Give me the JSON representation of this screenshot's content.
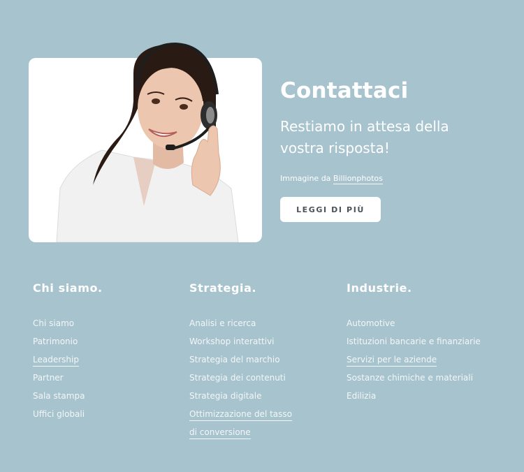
{
  "hero": {
    "image_alt": "Operatrice con cuffie e microfono sorridente",
    "title": "Contattaci",
    "subtitle": "Restiamo in attesa della vostra risposta!",
    "credit_prefix": "Immagine da",
    "credit_link": "Billionphotos",
    "button_label": "LEGGI DI PIÙ"
  },
  "columns": [
    {
      "heading": "Chi siamo.",
      "items": [
        {
          "label": "Chi siamo",
          "underlined": false
        },
        {
          "label": "Patrimonio",
          "underlined": false
        },
        {
          "label": "Leadership",
          "underlined": true
        },
        {
          "label": "Partner",
          "underlined": false
        },
        {
          "label": "Sala stampa",
          "underlined": false
        },
        {
          "label": "Uffici globali",
          "underlined": false
        }
      ]
    },
    {
      "heading": "Strategia.",
      "items": [
        {
          "label": "Analisi e ricerca",
          "underlined": false
        },
        {
          "label": "Workshop interattivi",
          "underlined": false
        },
        {
          "label": "Strategia del marchio",
          "underlined": false
        },
        {
          "label": "Strategia dei contenuti",
          "underlined": false
        },
        {
          "label": "Strategia digitale",
          "underlined": false
        },
        {
          "label": "Ottimizzazione del tasso di conversione",
          "underlined": true
        }
      ]
    },
    {
      "heading": "Industrie.",
      "items": [
        {
          "label": "Automotive",
          "underlined": false
        },
        {
          "label": "Istituzioni bancarie e finanziarie",
          "underlined": false
        },
        {
          "label": "Servizi per le aziende",
          "underlined": true
        },
        {
          "label": "Sostanze chimiche e materiali",
          "underlined": false
        },
        {
          "label": "Edilizia",
          "underlined": false
        }
      ]
    }
  ],
  "colors": {
    "background": "#a7c3ce",
    "card": "#ffffff",
    "button_text": "#4b5358"
  }
}
